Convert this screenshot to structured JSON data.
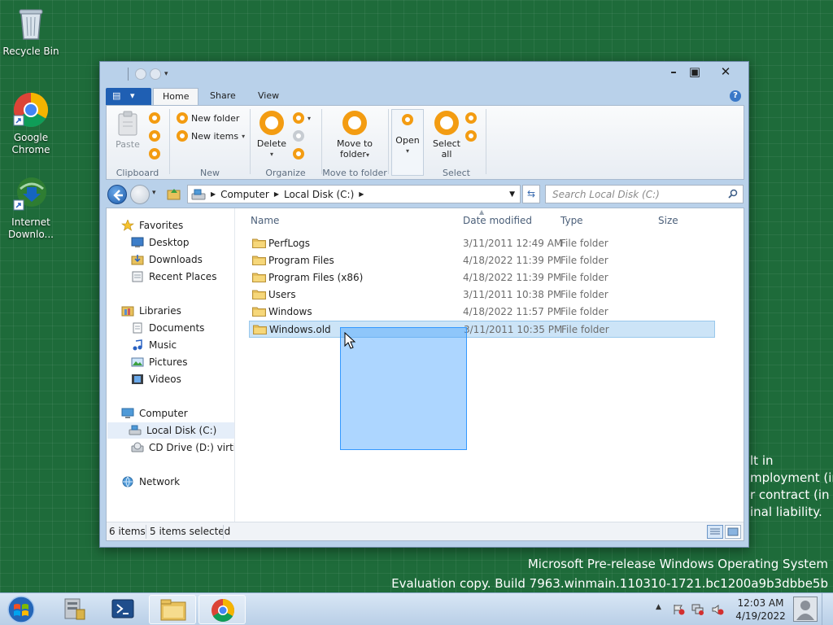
{
  "desktop": {
    "icons": [
      {
        "label": "Recycle Bin"
      },
      {
        "label": "Google Chrome"
      },
      {
        "label": "Internet Downlo..."
      }
    ],
    "background_text_peek": [
      "lt in",
      "mployment (in",
      "r contract (in",
      "inal liability."
    ],
    "watermark": {
      "line1": "Microsoft Pre-release Windows Operating System",
      "line2": "Evaluation copy. Build 7963.winmain.110310-1721.bc1200a9b3dbbe5b"
    }
  },
  "window": {
    "controls": {
      "minimize": "–",
      "maximize": "▣",
      "close": "✕"
    },
    "ribbon": {
      "tabs": [
        {
          "label": "Home",
          "active": true
        },
        {
          "label": "Share",
          "active": false
        },
        {
          "label": "View",
          "active": false
        }
      ],
      "help_glyph": "?",
      "groups": {
        "clipboard": {
          "label": "Clipboard",
          "paste": "Paste"
        },
        "new": {
          "label": "New",
          "new_folder": "New folder",
          "new_items": "New items"
        },
        "organize": {
          "label": "Organize",
          "delete": "Delete"
        },
        "move": {
          "label": "Move to folder",
          "move_to_line1": "Move to",
          "move_to_line2": "folder"
        },
        "open": {
          "label": "",
          "open": "Open"
        },
        "select": {
          "label": "Select",
          "select_all_line1": "Select",
          "select_all_line2": "all"
        }
      }
    },
    "address": {
      "crumbs": [
        "Computer",
        "Local Disk (C:)"
      ],
      "search_placeholder": "Search Local Disk (C:)"
    },
    "navigation_pane": {
      "favorites": {
        "label": "Favorites",
        "items": [
          "Desktop",
          "Downloads",
          "Recent Places"
        ]
      },
      "libraries": {
        "label": "Libraries",
        "items": [
          "Documents",
          "Music",
          "Pictures",
          "Videos"
        ]
      },
      "computer": {
        "label": "Computer",
        "items": [
          "Local Disk (C:)",
          "CD Drive (D:) virtio-w"
        ]
      },
      "network": {
        "label": "Network"
      }
    },
    "file_list": {
      "columns": {
        "name": "Name",
        "date": "Date modified",
        "type": "Type",
        "size": "Size"
      },
      "rows": [
        {
          "name": "PerfLogs",
          "date": "3/11/2011 12:49 AM",
          "type": "File folder",
          "selected": false
        },
        {
          "name": "Program Files",
          "date": "4/18/2022 11:39 PM",
          "type": "File folder",
          "selected": false
        },
        {
          "name": "Program Files (x86)",
          "date": "4/18/2022 11:39 PM",
          "type": "File folder",
          "selected": false
        },
        {
          "name": "Users",
          "date": "3/11/2011 10:38 PM",
          "type": "File folder",
          "selected": false
        },
        {
          "name": "Windows",
          "date": "4/18/2022 11:57 PM",
          "type": "File folder",
          "selected": false
        },
        {
          "name": "Windows.old",
          "date": "3/11/2011 10:35 PM",
          "type": "File folder",
          "selected": true
        }
      ]
    },
    "status": {
      "item_count": "6 items",
      "selected_count": "5 items selected"
    }
  },
  "taskbar": {
    "pinned": [
      "server-manager",
      "powershell",
      "file-explorer",
      "google-chrome"
    ],
    "clock": {
      "time": "12:03 AM",
      "date": "4/19/2022"
    }
  },
  "colors": {
    "desktop": "#1e6b3a",
    "accent": "#1f5fb3",
    "ribbon_icon": "#f39c12",
    "selection": "#cce4f7"
  }
}
